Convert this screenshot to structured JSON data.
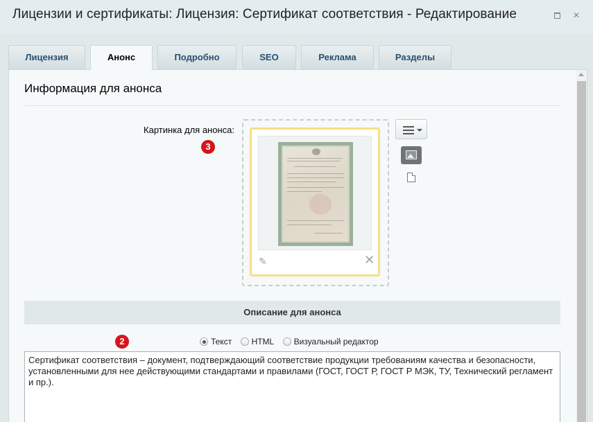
{
  "window": {
    "title": "Лицензии и сертификаты: Лицензия: Сертификат соответствия - Редактирование",
    "maximize_icon": "maximize-icon",
    "close_glyph": "×"
  },
  "tabs": [
    {
      "label": "Лицензия",
      "active": false
    },
    {
      "label": "Анонс",
      "active": true
    },
    {
      "label": "Подробно",
      "active": false
    },
    {
      "label": "SEO",
      "active": false
    },
    {
      "label": "Реклама",
      "active": false
    },
    {
      "label": "Разделы",
      "active": false
    }
  ],
  "section": {
    "title": "Информация для анонса",
    "image_label": "Картинка для анонса:",
    "badge_image": "3",
    "image_actions": {
      "edit_icon": "pencil-icon",
      "remove_glyph": "✕"
    },
    "side_tools": [
      "menu-icon",
      "image-icon",
      "file-icon"
    ]
  },
  "description": {
    "header": "Описание для анонса",
    "badge": "2",
    "modes": [
      {
        "label": "Текст",
        "checked": true
      },
      {
        "label": "HTML",
        "checked": false
      },
      {
        "label": "Визуальный редактор",
        "checked": false
      }
    ],
    "text": "Сертификат соответствия – документ, подтверждающий соответствие продукции требованиям качества и безопасности, установленными для нее действующими стандартами и правилами (ГОСТ, ГОСТ Р, ГОСТ Р МЭК, ТУ, Технический регламент и пр.)."
  },
  "colors": {
    "badge": "#d5141b",
    "image_frame": "#f6df86",
    "tab_text": "#2a4f6f"
  }
}
